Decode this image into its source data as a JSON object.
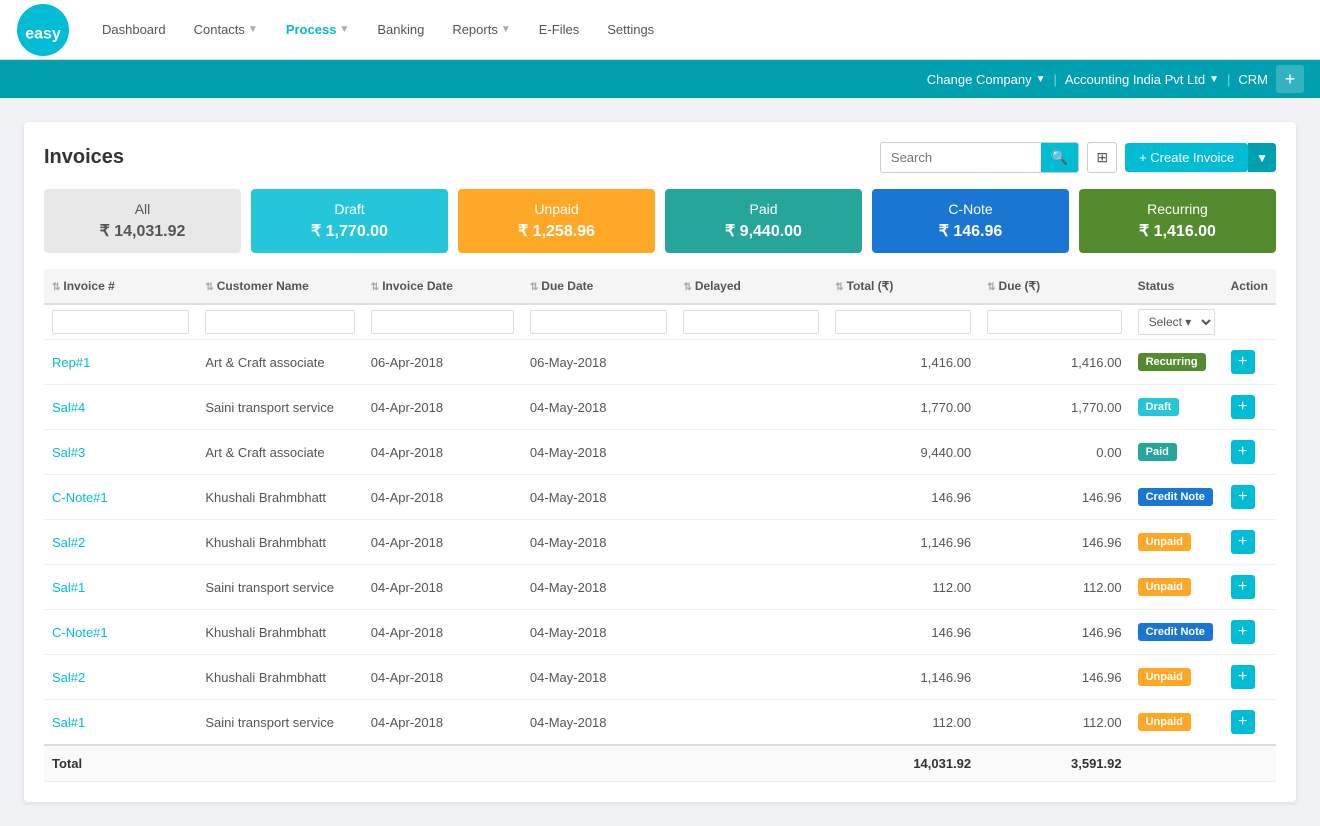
{
  "app": {
    "logo_text": "easy"
  },
  "nav": {
    "items": [
      {
        "label": "Dashboard",
        "active": false,
        "has_arrow": false
      },
      {
        "label": "Contacts",
        "active": false,
        "has_arrow": true
      },
      {
        "label": "Process",
        "active": true,
        "has_arrow": true
      },
      {
        "label": "Banking",
        "active": false,
        "has_arrow": false
      },
      {
        "label": "Reports",
        "active": false,
        "has_arrow": true
      },
      {
        "label": "E-Files",
        "active": false,
        "has_arrow": false
      },
      {
        "label": "Settings",
        "active": false,
        "has_arrow": false
      }
    ]
  },
  "header_bar": {
    "change_company": "Change Company",
    "company_name": "Accounting India Pvt Ltd",
    "crm": "CRM",
    "plus": "+"
  },
  "page": {
    "title": "Invoices",
    "search_placeholder": "Search"
  },
  "toolbar": {
    "create_label": "+ Create Invoice",
    "create_arrow": "▼"
  },
  "status_tabs": [
    {
      "key": "all",
      "label": "All",
      "amount": "₹ 14,031.92",
      "css": "tab-all"
    },
    {
      "key": "draft",
      "label": "Draft",
      "amount": "₹ 1,770.00",
      "css": "tab-draft"
    },
    {
      "key": "unpaid",
      "label": "Unpaid",
      "amount": "₹ 1,258.96",
      "css": "tab-unpaid"
    },
    {
      "key": "paid",
      "label": "Paid",
      "amount": "₹ 9,440.00",
      "css": "tab-paid"
    },
    {
      "key": "cnote",
      "label": "C-Note",
      "amount": "₹ 146.96",
      "css": "tab-cnote"
    },
    {
      "key": "recurring",
      "label": "Recurring",
      "amount": "₹ 1,416.00",
      "css": "tab-recurring"
    }
  ],
  "table": {
    "columns": [
      {
        "label": "Invoice #",
        "sortable": true
      },
      {
        "label": "Customer Name",
        "sortable": true
      },
      {
        "label": "Invoice Date",
        "sortable": true
      },
      {
        "label": "Due Date",
        "sortable": true
      },
      {
        "label": "Delayed",
        "sortable": true
      },
      {
        "label": "Total (₹)",
        "sortable": true
      },
      {
        "label": "Due (₹)",
        "sortable": true
      },
      {
        "label": "Status",
        "sortable": false
      },
      {
        "label": "Action",
        "sortable": false
      }
    ],
    "filter_placeholder_select": "Select ▾",
    "rows": [
      {
        "invoice": "Rep#1",
        "customer": "Art & Craft associate",
        "inv_date": "06-Apr-2018",
        "due_date": "06-May-2018",
        "delayed": "",
        "total": "1,416.00",
        "due": "1,416.00",
        "status": "Recurring",
        "status_css": "badge-recurring"
      },
      {
        "invoice": "Sal#4",
        "customer": "Saini transport service",
        "inv_date": "04-Apr-2018",
        "due_date": "04-May-2018",
        "delayed": "",
        "total": "1,770.00",
        "due": "1,770.00",
        "status": "Draft",
        "status_css": "badge-draft"
      },
      {
        "invoice": "Sal#3",
        "customer": "Art & Craft associate",
        "inv_date": "04-Apr-2018",
        "due_date": "04-May-2018",
        "delayed": "",
        "total": "9,440.00",
        "due": "0.00",
        "status": "Paid",
        "status_css": "badge-paid"
      },
      {
        "invoice": "C-Note#1",
        "customer": "Khushali Brahmbhatt",
        "inv_date": "04-Apr-2018",
        "due_date": "04-May-2018",
        "delayed": "",
        "total": "146.96",
        "due": "146.96",
        "status": "Credit Note",
        "status_css": "badge-credit-note"
      },
      {
        "invoice": "Sal#2",
        "customer": "Khushali Brahmbhatt",
        "inv_date": "04-Apr-2018",
        "due_date": "04-May-2018",
        "delayed": "",
        "total": "1,146.96",
        "due": "146.96",
        "status": "Unpaid",
        "status_css": "badge-unpaid"
      },
      {
        "invoice": "Sal#1",
        "customer": "Saini transport service",
        "inv_date": "04-Apr-2018",
        "due_date": "04-May-2018",
        "delayed": "",
        "total": "112.00",
        "due": "112.00",
        "status": "Unpaid",
        "status_css": "badge-unpaid"
      },
      {
        "invoice": "C-Note#1",
        "customer": "Khushali Brahmbhatt",
        "inv_date": "04-Apr-2018",
        "due_date": "04-May-2018",
        "delayed": "",
        "total": "146.96",
        "due": "146.96",
        "status": "Credit Note",
        "status_css": "badge-credit-note"
      },
      {
        "invoice": "Sal#2",
        "customer": "Khushali Brahmbhatt",
        "inv_date": "04-Apr-2018",
        "due_date": "04-May-2018",
        "delayed": "",
        "total": "1,146.96",
        "due": "146.96",
        "status": "Unpaid",
        "status_css": "badge-unpaid"
      },
      {
        "invoice": "Sal#1",
        "customer": "Saini transport service",
        "inv_date": "04-Apr-2018",
        "due_date": "04-May-2018",
        "delayed": "",
        "total": "112.00",
        "due": "112.00",
        "status": "Unpaid",
        "status_css": "badge-unpaid"
      }
    ],
    "total_label": "Total",
    "total_amount": "14,031.92",
    "total_due": "3,591.92"
  }
}
